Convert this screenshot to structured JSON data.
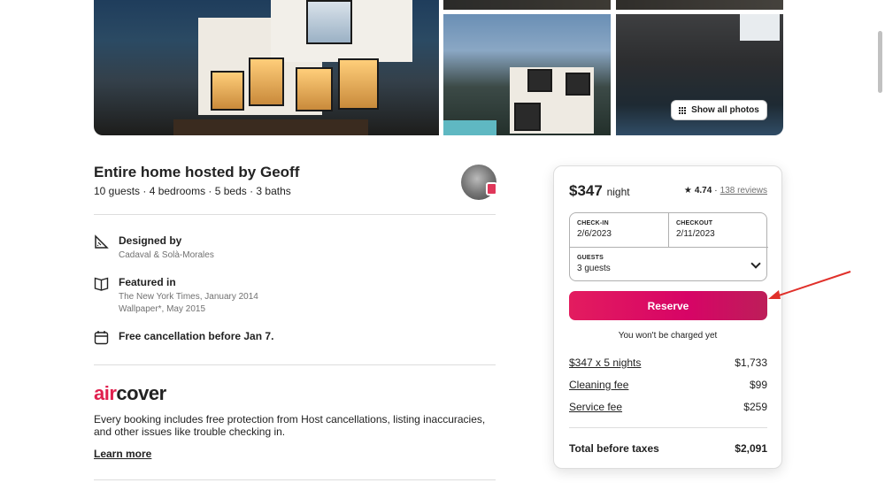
{
  "gallery": {
    "show_all_photos_label": "Show all photos"
  },
  "listing": {
    "title": "Entire home hosted by Geoff",
    "subtitle": "10 guests · 4 bedrooms · 5 beds · 3 baths"
  },
  "features": [
    {
      "icon": "design-icon",
      "title": "Designed by",
      "lines": [
        "Cadaval & Solà-Morales"
      ]
    },
    {
      "icon": "book-icon",
      "title": "Featured in",
      "lines": [
        "The New York Times, January 2014",
        "Wallpaper*, May 2015"
      ]
    },
    {
      "icon": "calendar-icon",
      "title": "Free cancellation before Jan 7.",
      "lines": []
    }
  ],
  "aircover": {
    "logo_air": "air",
    "logo_cover": "cover",
    "description": "Every booking includes free protection from Host cancellations, listing inaccuracies, and other issues like trouble checking in.",
    "learn_more": "Learn more"
  },
  "booking": {
    "price": "$347",
    "price_unit": "night",
    "rating": "4.74",
    "separator": "·",
    "reviews": "138 reviews",
    "checkin_label": "CHECK-IN",
    "checkin_value": "2/6/2023",
    "checkout_label": "CHECKOUT",
    "checkout_value": "2/11/2023",
    "guests_label": "GUESTS",
    "guests_value": "3 guests",
    "reserve_label": "Reserve",
    "no_charge_text": "You won't be charged yet",
    "line_items": [
      {
        "label": "$347 x 5 nights",
        "amount": "$1,733"
      },
      {
        "label": "Cleaning fee",
        "amount": "$99"
      },
      {
        "label": "Service fee",
        "amount": "$259"
      }
    ],
    "total_label": "Total before taxes",
    "total_amount": "$2,091"
  },
  "colors": {
    "brand": "#e31c5f",
    "annotation_arrow": "#e0302a"
  }
}
